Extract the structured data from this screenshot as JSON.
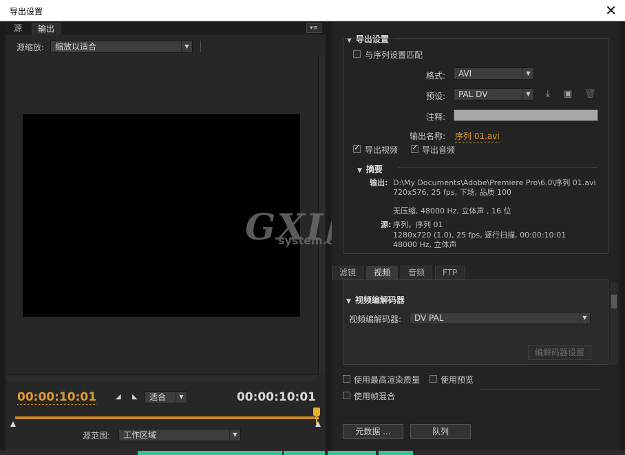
{
  "window": {
    "title": "导出设置",
    "close_glyph": "✕"
  },
  "left": {
    "tabs": [
      "源",
      "输出"
    ],
    "panel_menu_glyph": "▾≡",
    "source_zoom_label": "源缩放:",
    "source_zoom_value": "缩放以适合",
    "current_time": "00:00:10:01",
    "duration": "00:00:10:01",
    "fit_value": "适合",
    "range_label": "源范围:",
    "range_value": "工作区域"
  },
  "right": {
    "export_settings_header": "导出设置",
    "match_sequence_label": "与序列设置匹配",
    "match_sequence_checked": false,
    "format_label": "格式:",
    "format_value": "AVI",
    "preset_label": "预设:",
    "preset_value": "PAL DV",
    "comment_label": "注释:",
    "comment_value": "",
    "output_name_label": "输出名称:",
    "output_name_value": "序列 01.avi",
    "export_video_label": "导出视频",
    "export_video_checked": true,
    "export_audio_label": "导出音频",
    "export_audio_checked": true,
    "summary_header": "摘要",
    "summary_output_label": "输出:",
    "summary_output_path": "D:\\My Documents\\Adobe\\Premiere Pro\\6.0\\序列 01.avi",
    "summary_output_video": "720x576, 25 fps, 下场, 品质  100",
    "summary_output_audio": "无压缩, 48000 Hz, 立体声 , 16 位",
    "summary_source_label": "源:",
    "summary_source_name": "序列，序列 01",
    "summary_source_video": "1280x720 (1.0), 25 fps, 逐行扫描, 00:00:10:01",
    "summary_source_audio": "48000 Hz, 立体声",
    "sub_tabs": [
      "滤镜",
      "视频",
      "音频",
      "FTP"
    ],
    "video_codec_header": "视频编解码器",
    "video_codec_label": "视频编解码器:",
    "video_codec_value": "DV PAL",
    "codec_settings_button": "编解码器设置",
    "max_render_quality_label": "使用最高渲染质量",
    "max_render_quality_checked": false,
    "use_previews_label": "使用预览",
    "use_previews_checked": false,
    "frame_blending_label": "使用帧混合",
    "frame_blending_checked": false,
    "metadata_button": "元数据 ...",
    "queue_button": "队列"
  },
  "watermark": {
    "logo": "GXI网",
    "site": "system.com"
  },
  "colors": {
    "accent_orange": "#e09b2c",
    "background": "#232323",
    "strip_green": "#3cbf97"
  }
}
